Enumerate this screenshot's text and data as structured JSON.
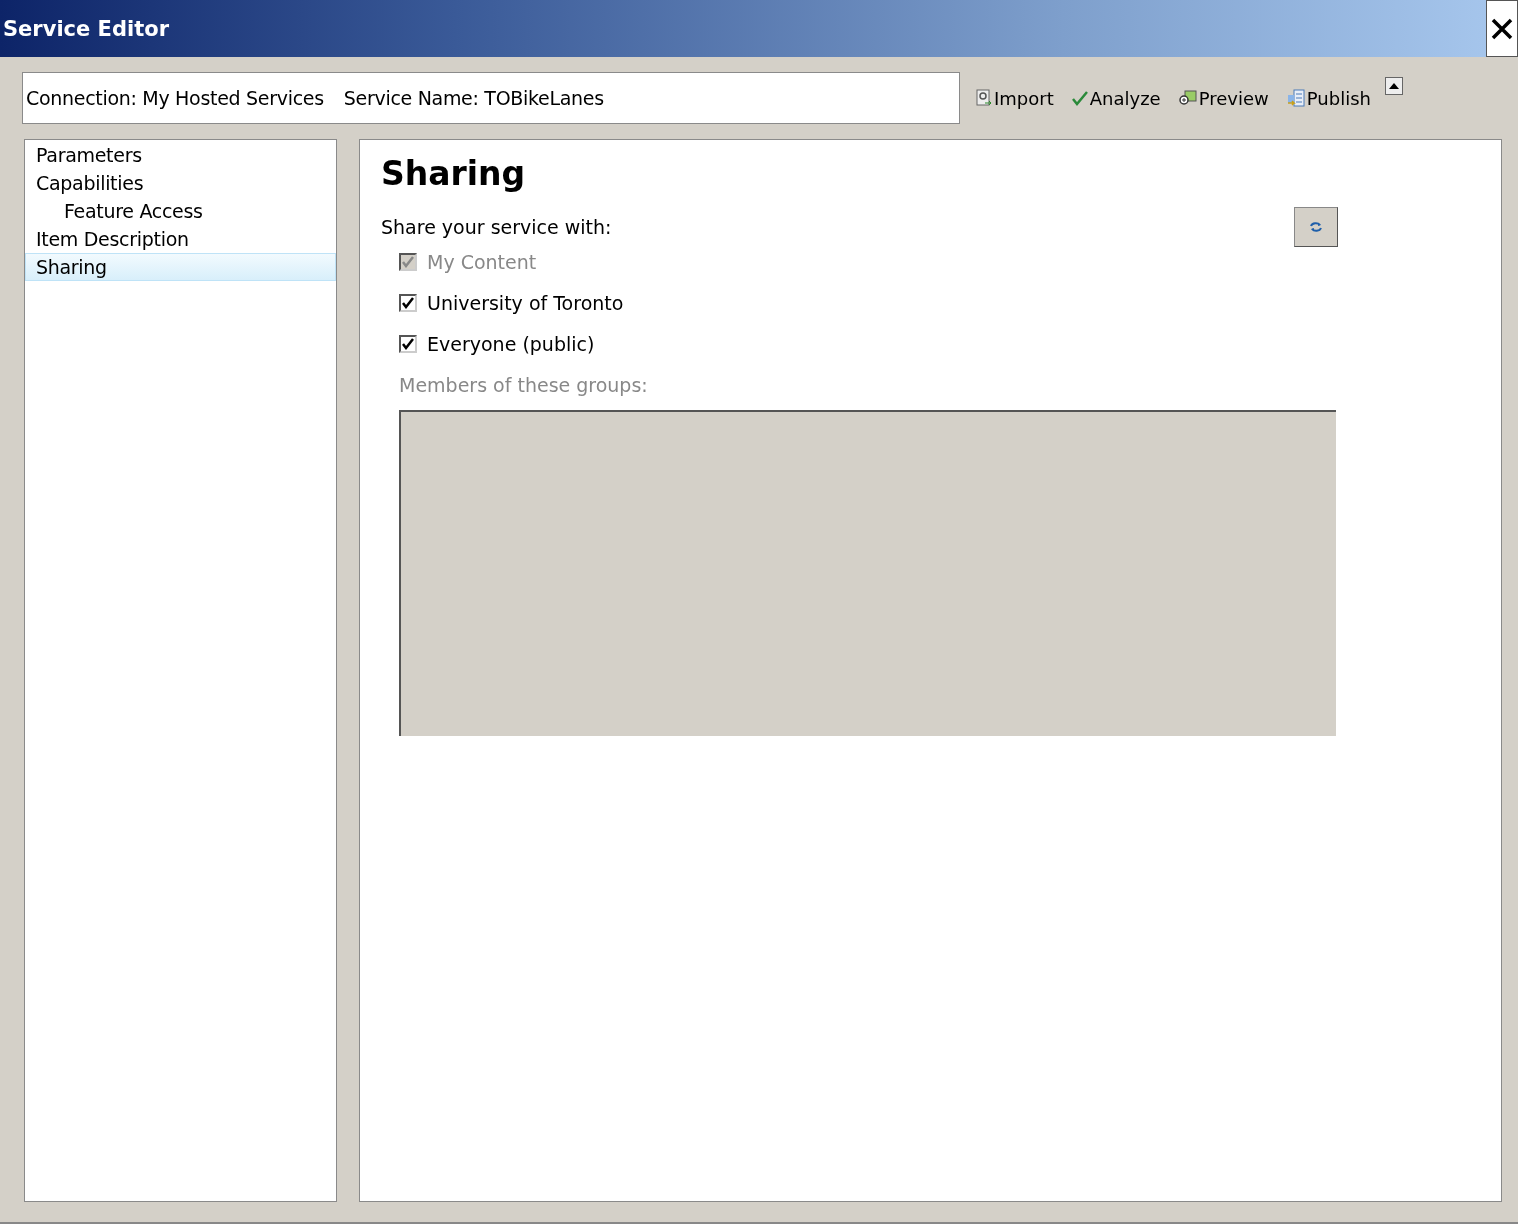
{
  "window": {
    "title": "Service Editor"
  },
  "header": {
    "connection": "Connection: My Hosted Services",
    "service_name": "Service Name: TOBikeLanes"
  },
  "toolbar": [
    {
      "kind": "import",
      "label": "Import"
    },
    {
      "kind": "analyze",
      "label": "Analyze"
    },
    {
      "kind": "preview",
      "label": "Preview"
    },
    {
      "kind": "publish",
      "label": "Publish"
    }
  ],
  "sidebar": {
    "items": [
      {
        "label": "Parameters",
        "selected": false
      },
      {
        "label": "Capabilities",
        "selected": false,
        "children": [
          {
            "label": "Feature Access",
            "selected": false
          }
        ]
      },
      {
        "label": "Item Description",
        "selected": false
      },
      {
        "label": "Sharing",
        "selected": true
      }
    ]
  },
  "panel": {
    "title": "Sharing",
    "prompt": "Share your service with:",
    "options": [
      {
        "label": "My Content",
        "checked": true,
        "disabled": true
      },
      {
        "label": "University of Toronto",
        "checked": true,
        "disabled": false
      },
      {
        "label": "Everyone (public)",
        "checked": true,
        "disabled": false
      }
    ],
    "groups_label": "Members of these groups:"
  }
}
